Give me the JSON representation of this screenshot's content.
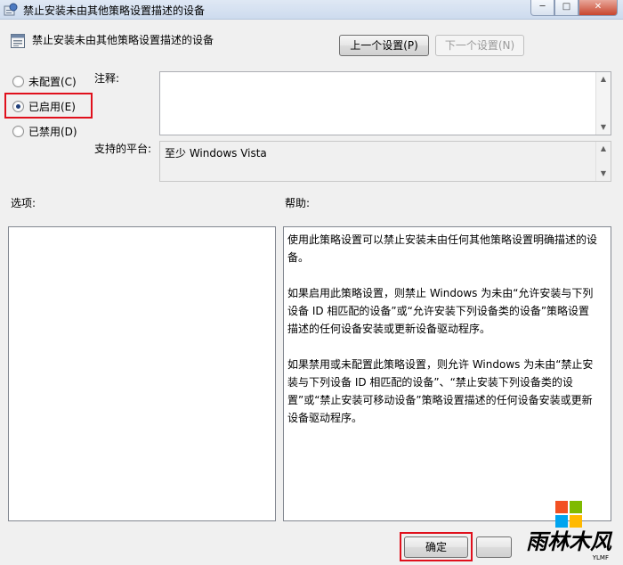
{
  "window": {
    "title": "禁止安装未由其他策略设置描述的设备",
    "buttons": {
      "minimize": "─",
      "maximize": "□",
      "close": "✕"
    }
  },
  "header": {
    "title": "禁止安装未由其他策略设置描述的设备",
    "prev_button": "上一个设置(P)",
    "next_button": "下一个设置(N)"
  },
  "state": {
    "options": [
      {
        "label": "未配置(C)",
        "checked": false
      },
      {
        "label": "已启用(E)",
        "checked": true
      },
      {
        "label": "已禁用(D)",
        "checked": false
      }
    ]
  },
  "comment": {
    "label": "注释:",
    "value": ""
  },
  "platform": {
    "label": "支持的平台:",
    "value": "至少 Windows Vista"
  },
  "options_section": {
    "label": "选项:"
  },
  "help_section": {
    "label": "帮助:",
    "paragraphs": [
      "使用此策略设置可以禁止安装未由任何其他策略设置明确描述的设备。",
      "如果启用此策略设置，则禁止 Windows 为未由“允许安装与下列设备 ID 相匹配的设备”或“允许安装下列设备类的设备”策略设置描述的任何设备安装或更新设备驱动程序。",
      "如果禁用或未配置此策略设置，则允许 Windows 为未由“禁止安装与下列设备 ID 相匹配的设备”、“禁止安装下列设备类的设置”或“禁止安装可移动设备”策略设置描述的任何设备安装或更新设备驱动程序。"
    ]
  },
  "footer": {
    "ok_button": "确定"
  },
  "watermark": {
    "text": "雨林木风",
    "sub": "YLMF"
  },
  "colors": {
    "highlight": "#e0101c",
    "win_red": "#f25022",
    "win_green": "#7fba00",
    "win_blue": "#00a4ef",
    "win_yellow": "#ffb900"
  }
}
